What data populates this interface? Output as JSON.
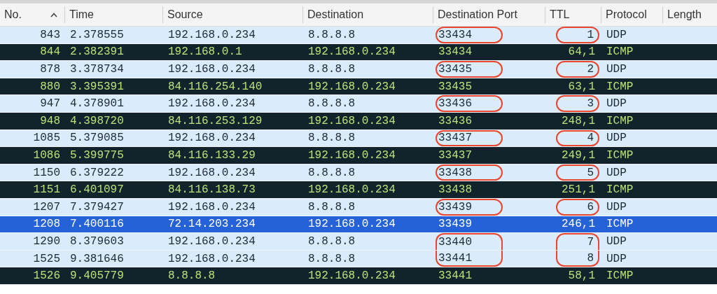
{
  "columns": [
    {
      "label": "No.",
      "sorted": true
    },
    {
      "label": "Time",
      "sorted": false
    },
    {
      "label": "Source",
      "sorted": false
    },
    {
      "label": "Destination",
      "sorted": false
    },
    {
      "label": "Destination Port",
      "sorted": false
    },
    {
      "label": "TTL",
      "sorted": false
    },
    {
      "label": "Protocol",
      "sorted": false
    },
    {
      "label": "Length",
      "sorted": false
    }
  ],
  "rows": [
    {
      "kind": "udp",
      "selected": false,
      "circled": true,
      "cells": [
        "843",
        "2.378555",
        "192.168.0.234",
        "8.8.8.8",
        "33434",
        "1",
        "UDP"
      ]
    },
    {
      "kind": "icmp",
      "selected": false,
      "circled": false,
      "cells": [
        "844",
        "2.382391",
        "192.168.0.1",
        "192.168.0.234",
        "33434",
        "64,1",
        "ICMP"
      ]
    },
    {
      "kind": "udp",
      "selected": false,
      "circled": true,
      "cells": [
        "878",
        "3.378734",
        "192.168.0.234",
        "8.8.8.8",
        "33435",
        "2",
        "UDP"
      ]
    },
    {
      "kind": "icmp",
      "selected": false,
      "circled": false,
      "cells": [
        "880",
        "3.395391",
        "84.116.254.140",
        "192.168.0.234",
        "33435",
        "63,1",
        "ICMP"
      ]
    },
    {
      "kind": "udp",
      "selected": false,
      "circled": true,
      "cells": [
        "947",
        "4.378901",
        "192.168.0.234",
        "8.8.8.8",
        "33436",
        "3",
        "UDP"
      ]
    },
    {
      "kind": "icmp",
      "selected": false,
      "circled": false,
      "cells": [
        "948",
        "4.398720",
        "84.116.253.129",
        "192.168.0.234",
        "33436",
        "248,1",
        "ICMP"
      ]
    },
    {
      "kind": "udp",
      "selected": false,
      "circled": true,
      "cells": [
        "1085",
        "5.379085",
        "192.168.0.234",
        "8.8.8.8",
        "33437",
        "4",
        "UDP"
      ]
    },
    {
      "kind": "icmp",
      "selected": false,
      "circled": false,
      "cells": [
        "1086",
        "5.399775",
        "84.116.133.29",
        "192.168.0.234",
        "33437",
        "249,1",
        "ICMP"
      ]
    },
    {
      "kind": "udp",
      "selected": false,
      "circled": true,
      "cells": [
        "1150",
        "6.379222",
        "192.168.0.234",
        "8.8.8.8",
        "33438",
        "5",
        "UDP"
      ]
    },
    {
      "kind": "icmp",
      "selected": false,
      "circled": false,
      "cells": [
        "1151",
        "6.401097",
        "84.116.138.73",
        "192.168.0.234",
        "33438",
        "251,1",
        "ICMP"
      ]
    },
    {
      "kind": "udp",
      "selected": false,
      "circled": true,
      "cells": [
        "1207",
        "7.379427",
        "192.168.0.234",
        "8.8.8.8",
        "33439",
        "6",
        "UDP"
      ]
    },
    {
      "kind": "icmp",
      "selected": true,
      "circled": false,
      "cells": [
        "1208",
        "7.400116",
        "72.14.203.234",
        "192.168.0.234",
        "33439",
        "246,1",
        "ICMP"
      ]
    },
    {
      "kind": "udp",
      "selected": false,
      "circled": true,
      "cells": [
        "1290",
        "8.379603",
        "192.168.0.234",
        "8.8.8.8",
        "33440",
        "7",
        "UDP"
      ]
    },
    {
      "kind": "udp",
      "selected": false,
      "circled": true,
      "cells": [
        "1525",
        "9.381646",
        "192.168.0.234",
        "8.8.8.8",
        "33441",
        "8",
        "UDP"
      ]
    },
    {
      "kind": "icmp",
      "selected": false,
      "circled": false,
      "cells": [
        "1526",
        "9.405779",
        "8.8.8.8",
        "192.168.0.234",
        "33441",
        "58,1",
        "ICMP"
      ]
    }
  ]
}
